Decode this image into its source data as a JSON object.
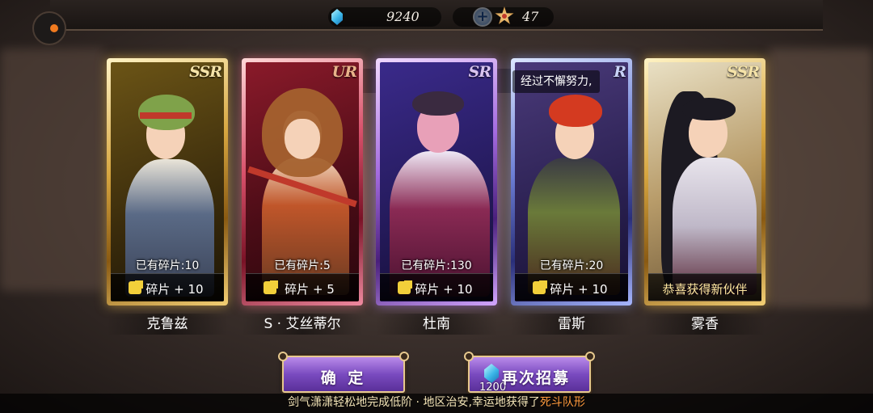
{
  "resources": {
    "gems": "9240",
    "stars": "47"
  },
  "speech_text": "经过不懈努力,",
  "cards": [
    {
      "rarity": "SSR",
      "shards_owned": "已有碎片:10",
      "banner": "碎片 + 10",
      "name": "克鲁兹"
    },
    {
      "rarity": "UR",
      "shards_owned": "已有碎片:5",
      "banner": "碎片 + 5",
      "name": "S · 艾丝蒂尔"
    },
    {
      "rarity": "SR",
      "shards_owned": "已有碎片:130",
      "banner": "碎片 + 10",
      "name": "杜南"
    },
    {
      "rarity": "R",
      "shards_owned": "已有碎片:20",
      "banner": "碎片 + 10",
      "name": "雷斯"
    },
    {
      "rarity": "SSR",
      "shards_owned": "",
      "banner": "恭喜获得新伙伴",
      "name": "雾香"
    }
  ],
  "buttons": {
    "confirm_label": "确 定",
    "again_label": "再次招募",
    "again_cost": "1200"
  },
  "ticker": {
    "text": "剑气潇潇轻松地完成低阶 · 地区治安,幸运地获得了",
    "highlight": "死斗队形"
  },
  "colors": {
    "ssr": "#d7a640",
    "ur": "#d8506a",
    "sr": "#a46be0",
    "r": "#6d7fd6",
    "ticker_highlight": "#ff9a3c"
  }
}
